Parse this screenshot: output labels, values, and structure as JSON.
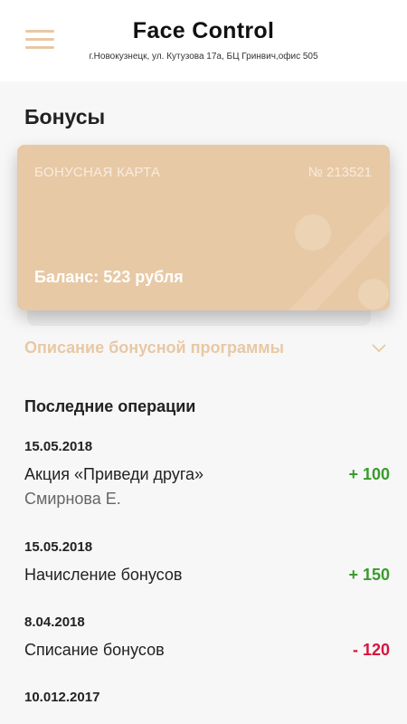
{
  "header": {
    "title": "Face Control",
    "address": "г.Новокузнецк, ул. Кутузова 17а, БЦ Гринвич,офис 505"
  },
  "page": {
    "title": "Бонусы"
  },
  "card": {
    "label": "БОНУСНАЯ КАРТА",
    "number": "№ 213521",
    "balance": "Баланс: 523 рубля"
  },
  "program": {
    "label": "Описание бонусной программы"
  },
  "operations": {
    "title": "Последние операции",
    "items": [
      {
        "date": "15.05.2018",
        "title": "Акция «Приведи друга»",
        "subtitle": "Смирнова Е.",
        "amount": "+ 100"
      },
      {
        "date": "15.05.2018",
        "title": "Начисление бонусов",
        "amount": "+ 150"
      },
      {
        "date": "8.04.2018",
        "title": "Списание бонусов",
        "amount": "- 120"
      },
      {
        "date": "10.012.2017"
      }
    ]
  },
  "colors": {
    "accent": "#e8c8a4",
    "positive": "#3a9a2e",
    "negative": "#d6153c"
  }
}
